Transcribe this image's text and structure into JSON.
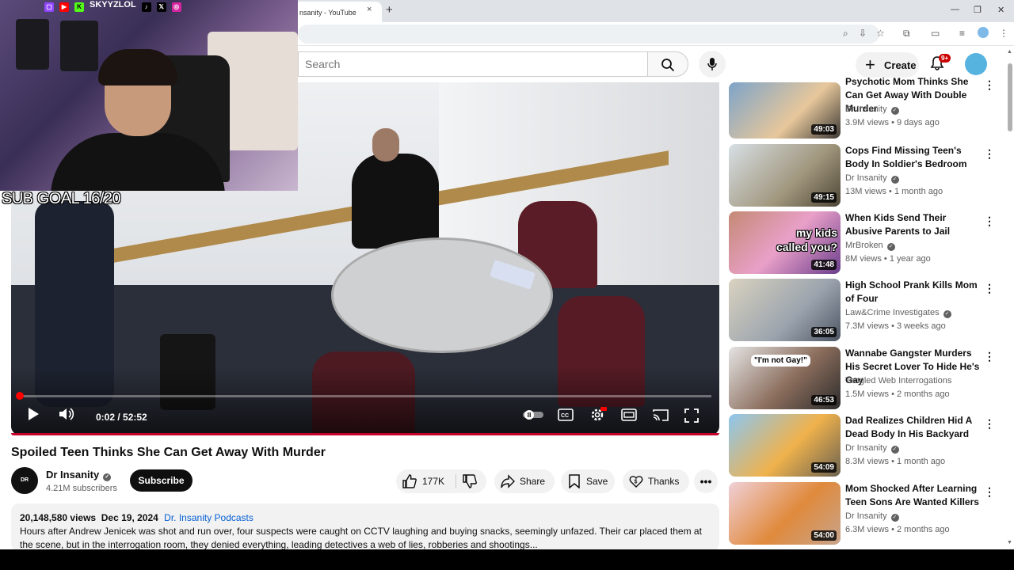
{
  "browser": {
    "tab_title": "nsanity - YouTube",
    "tab_close": "×",
    "new_tab": "+",
    "win_minimize": "—",
    "win_restore": "❐",
    "win_close": "✕"
  },
  "header": {
    "search_placeholder": "Search",
    "create_label": "Create",
    "notifications_badge": "9+"
  },
  "overlay": {
    "streamer_handle": "SKYYZLOL",
    "sub_goal": "SUB GOAL 16/20"
  },
  "player": {
    "current_time": "0:02",
    "duration": "52:52",
    "time_display": "0:02 / 52:52",
    "progress_fraction": 0.001
  },
  "video": {
    "title": "Spoiled Teen Thinks She Can Get Away With Murder",
    "channel_name": "Dr Insanity",
    "channel_avatar_text": "DR INSANITY",
    "subscribers": "4.21M subscribers",
    "subscribe_label": "Subscribe",
    "likes": "177K",
    "share_label": "Share",
    "save_label": "Save",
    "thanks_label": "Thanks",
    "more_label": "•••",
    "views": "20,148,580 views",
    "date": "Dec 19, 2024",
    "playlist_link": "Dr. Insanity Podcasts",
    "description": "Hours after Andrew Jenicek was shot and run over, four suspects were caught on CCTV laughing and buying snacks, seemingly unfazed. Their car placed them at the scene, but in the interrogation room, they denied everything, leading detectives a web of lies, robberies and shootings..."
  },
  "sidebar": {
    "items": [
      {
        "title": "Psychotic Mom Thinks She Can Get Away With Double Murder",
        "channel": "Dr Insanity",
        "verified": true,
        "views": "3.9M views",
        "age": "9 days ago",
        "duration": "49:03",
        "thumb_text": ""
      },
      {
        "title": "Cops Find Missing Teen's Body In Soldier's Bedroom",
        "channel": "Dr Insanity",
        "verified": true,
        "views": "13M views",
        "age": "1 month ago",
        "duration": "49:15",
        "thumb_text": ""
      },
      {
        "title": "When Kids Send Their Abusive Parents to Jail",
        "channel": "MrBroken",
        "verified": true,
        "views": "8M views",
        "age": "1 year ago",
        "duration": "41:48",
        "thumb_text": "my kids called you?"
      },
      {
        "title": "High School Prank Kills Mom of Four",
        "channel": "Law&Crime Investigates",
        "verified": true,
        "views": "7.3M views",
        "age": "3 weeks ago",
        "duration": "36:05",
        "thumb_text": ""
      },
      {
        "title": "Wannabe Gangster Murders His Secret Lover To Hide He's Gay",
        "channel": "Tangled Web Interrogations",
        "verified": false,
        "views": "1.5M views",
        "age": "2 months ago",
        "duration": "46:53",
        "thumb_text": "\"I'm not Gay!\""
      },
      {
        "title": "Dad Realizes Children Hid A Dead Body In His Backyard",
        "channel": "Dr Insanity",
        "verified": true,
        "views": "8.3M views",
        "age": "1 month ago",
        "duration": "54:09",
        "thumb_text": ""
      },
      {
        "title": "Mom Shocked After Learning Teen Sons Are Wanted Killers",
        "channel": "Dr Insanity",
        "verified": true,
        "views": "6.3M views",
        "age": "2 months ago",
        "duration": "54:00",
        "thumb_text": ""
      }
    ]
  },
  "colors": {
    "brand_red": "#ff0000",
    "subscribe_bg": "#0f0f0f",
    "link_blue": "#065fd4"
  }
}
